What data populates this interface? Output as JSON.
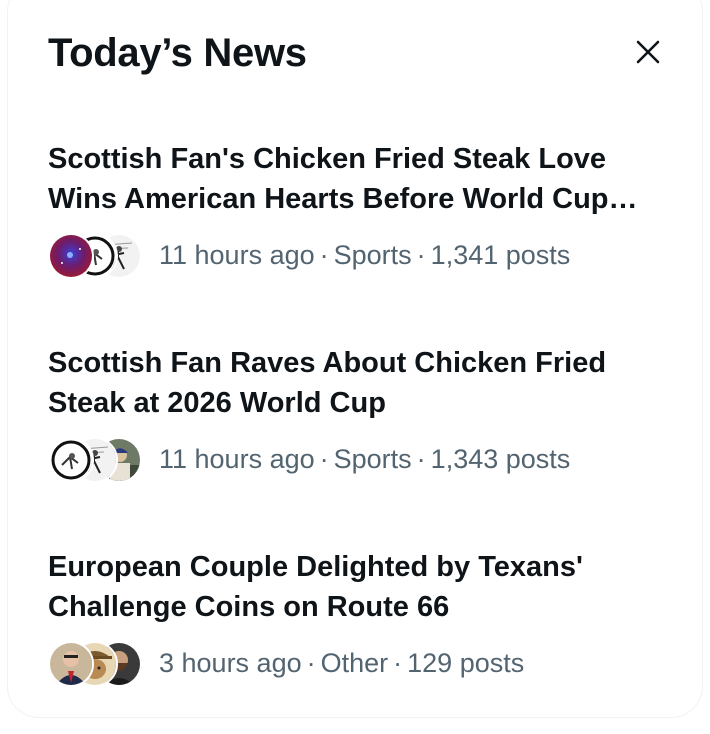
{
  "panel": {
    "title": "Today’s News",
    "close_label": "close"
  },
  "items": [
    {
      "headline": "Scottish Fan's Chicken Fried Steak Love Wins American Hearts Before World Cup Match",
      "time": "11 hours ago",
      "category": "Sports",
      "posts": "1,341 posts",
      "avatars": [
        "avatar-galaxy-icon",
        "avatar-cartoon-bug-icon",
        "avatar-comic-figure-icon"
      ]
    },
    {
      "headline": "Scottish Fan Raves About Chicken Fried Steak at 2026 World Cup",
      "time": "11 hours ago",
      "category": "Sports",
      "posts": "1,343 posts",
      "avatars": [
        "avatar-cartoon-bug-icon",
        "avatar-comic-figure-icon",
        "avatar-photo-person-icon"
      ]
    },
    {
      "headline": "European Couple Delighted by Texans' Challenge Coins on Route 66",
      "time": "3 hours ago",
      "category": "Other",
      "posts": "129 posts",
      "avatars": [
        "avatar-man-suit-icon",
        "avatar-dog-hat-icon",
        "avatar-bearded-man-icon"
      ]
    }
  ],
  "separator": "·"
}
